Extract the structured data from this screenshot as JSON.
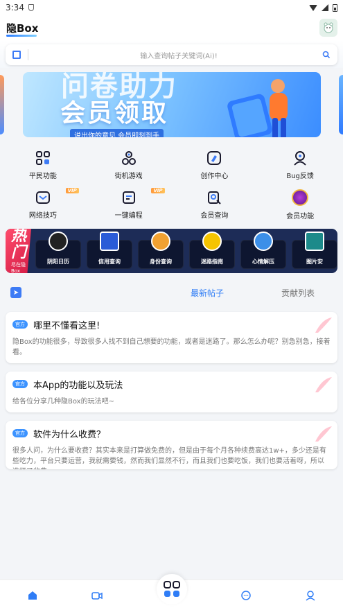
{
  "status": {
    "time": "3:34"
  },
  "header": {
    "title": "隐Box"
  },
  "search": {
    "placeholder": "输入查询帖子关键词(Ai)!"
  },
  "banner": {
    "title_top": "问卷助力",
    "title_main": "会员领取",
    "subtitle": "说出你的意见 会员即刻到手"
  },
  "features": [
    {
      "label": "平民功能",
      "icon": "grid-icon",
      "vip": ""
    },
    {
      "label": "街机游戏",
      "icon": "gamepad-icon",
      "vip": ""
    },
    {
      "label": "创作中心",
      "icon": "edit-icon",
      "vip": ""
    },
    {
      "label": "Bug反馈",
      "icon": "user-feedback-icon",
      "vip": ""
    },
    {
      "label": "网络技巧",
      "icon": "mail-icon",
      "vip": "VIP"
    },
    {
      "label": "一键编程",
      "icon": "code-icon",
      "vip": "VIP"
    },
    {
      "label": "会员查询",
      "icon": "search-member-icon",
      "vip": ""
    },
    {
      "label": "会员功能",
      "icon": "crown-icon",
      "vip": ""
    }
  ],
  "hot": {
    "title": "热门",
    "subtitle": "尽在隐Box",
    "items": [
      {
        "label": "阴阳日历",
        "color": "#222222"
      },
      {
        "label": "信用查询",
        "color": "#2a5bd7"
      },
      {
        "label": "身份查询",
        "color": "#f1a132"
      },
      {
        "label": "迷路指南",
        "color": "#f5c400"
      },
      {
        "label": "心情解压",
        "color": "#3c8fe8"
      },
      {
        "label": "图片安",
        "color": "#1d8a8a"
      }
    ]
  },
  "tabs": {
    "latest": "最新帖子",
    "contrib": "贡献列表"
  },
  "posts": [
    {
      "badge": "官方",
      "title": "哪里不懂看这里!",
      "body": "隐Box的功能很多，导致很多人找不到自己想要的功能，或者是迷路了。那么怎么办呢？别急别急，接着看。"
    },
    {
      "badge": "官方",
      "title": "本App的功能以及玩法",
      "body": "给各位分享几种隐Box的玩法吧~"
    },
    {
      "badge": "官方",
      "title": "软件为什么收费？",
      "body": "很多人问，为什么要收费？其实本来是打算做免费的，但是由于每个月各种续费高达1w+，多少还是有些吃力，平台只要运营，我就需要钱，然而我们显然不行，而且我们也要吃饭，我们也要活着呀，所以选择了收费"
    }
  ],
  "colors": {
    "accent": "#2f7df6",
    "hot": "#d41b45"
  }
}
